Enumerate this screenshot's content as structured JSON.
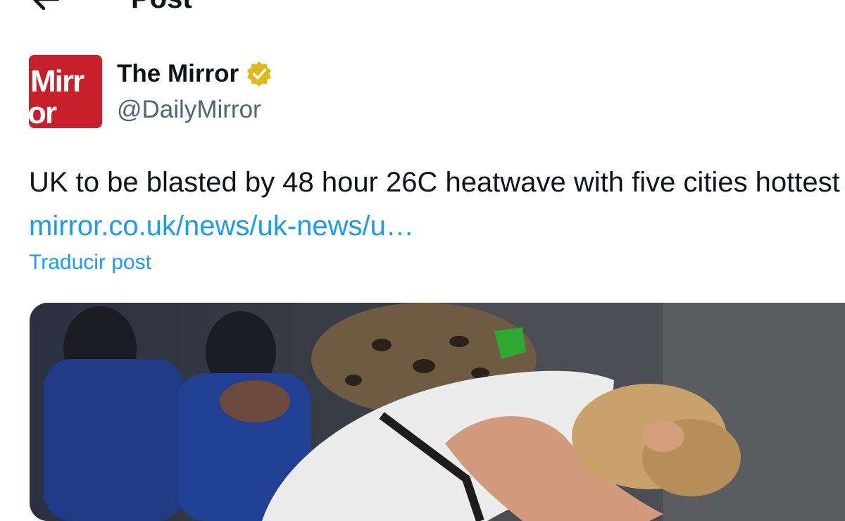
{
  "header": {
    "title": "Post",
    "back_icon": "arrow-left-icon"
  },
  "tweet": {
    "avatar_text": [
      "Mirr",
      "or"
    ],
    "author_name": "The Mirror",
    "verified_icon": "verified-badge-icon",
    "handle": "@DailyMirror",
    "text_before_link": "UK to be blasted by 48 hour 26C heatwave with five cities hottest ",
    "link_text": "mirror.co.uk/news/uk-news/u…",
    "translate_label": "Traducir post"
  },
  "colors": {
    "text": "#0f1419",
    "secondary_text": "#536471",
    "link": "#1d9bf0",
    "brand_red": "#c7202b",
    "verified_gold": "#e2b719"
  }
}
